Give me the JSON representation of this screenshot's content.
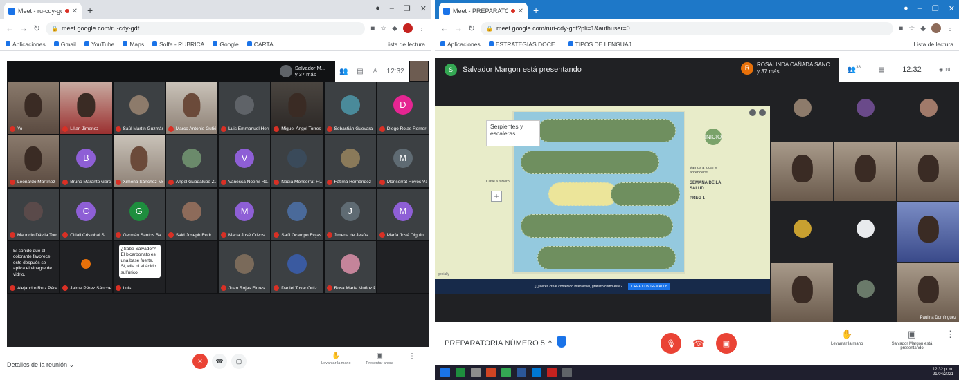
{
  "left": {
    "tab_title": "Meet - ru-cdy-gdf",
    "address": "meet.google.com/ru-cdy-gdf",
    "bookmarks": [
      "Aplicaciones",
      "Gmail",
      "YouTube",
      "Maps",
      "Solfe - RUBRICA",
      "Google",
      "CARTA ... "
    ],
    "bookmarks_right": "Lista de lectura",
    "presenter_caption": "Salvador M...\ny 37 más",
    "time": "12:32",
    "tiles": [
      {
        "type": "cam",
        "shade": "",
        "name": "Yo"
      },
      {
        "type": "cam",
        "shade": "red",
        "name": "Lilian Jimenez"
      },
      {
        "type": "avatar",
        "avatar": "",
        "color": "#8d7b6b",
        "name": "Saúl Martín Guzmán Ver..."
      },
      {
        "type": "cam",
        "shade": "light",
        "name": "Marco Antonio Gutiérrez"
      },
      {
        "type": "avatar",
        "avatar": "",
        "color": "#5f6368",
        "name": "Luis Emmanuel Herrera..."
      },
      {
        "type": "cam",
        "shade": "dark",
        "name": "Miguel Ángel Torres"
      },
      {
        "type": "avatar",
        "avatar": "",
        "color": "#4a8a9a",
        "name": "Sebastián Guevara"
      },
      {
        "type": "avatar",
        "avatar": "D",
        "color": "#e52592",
        "name": "Diego Rojas Romero"
      },
      {
        "type": "cam",
        "shade": "",
        "name": "Leonardo Martínez"
      },
      {
        "type": "avatar",
        "avatar": "B",
        "color": "#8e5fd6",
        "name": "Bruno Maranto García"
      },
      {
        "type": "cam",
        "shade": "light",
        "name": "Ximena Sánchez Mendoza"
      },
      {
        "type": "avatar",
        "avatar": "",
        "color": "#6b8a6b",
        "name": "Angel Guadalupe Zu..."
      },
      {
        "type": "avatar",
        "avatar": "V",
        "color": "#8e5fd6",
        "name": "Vanessa Noemí Ro..."
      },
      {
        "type": "avatar",
        "avatar": "",
        "color": "#3a4a5a",
        "name": "Nadia Monserrat Fl..."
      },
      {
        "type": "avatar",
        "avatar": "",
        "color": "#8a7a5a",
        "name": "Fátima Hernández"
      },
      {
        "type": "avatar",
        "avatar": "M",
        "color": "#5f6b73",
        "name": "Monserrat Reyes Vá..."
      },
      {
        "type": "avatar",
        "avatar": "",
        "color": "#5a4a4a",
        "name": "Mauricio Dávila Torres"
      },
      {
        "type": "avatar",
        "avatar": "C",
        "color": "#8e5fd6",
        "name": "Citlali Cristóbal S..."
      },
      {
        "type": "avatar",
        "avatar": "G",
        "color": "#1e8e3e",
        "name": "Germán Santos Ba..."
      },
      {
        "type": "avatar",
        "avatar": "",
        "color": "#8d6b5a",
        "name": "Said Joseph Rodr..."
      },
      {
        "type": "avatar",
        "avatar": "M",
        "color": "#8e5fd6",
        "name": "María José Olivos..."
      },
      {
        "type": "avatar",
        "avatar": "",
        "color": "#4a6a9a",
        "name": "Saúl Ocampo Rojas"
      },
      {
        "type": "avatar",
        "avatar": "J",
        "color": "#5f6b73",
        "name": "Jimena de Jesús..."
      },
      {
        "type": "avatar",
        "avatar": "M",
        "color": "#8e5fd6",
        "name": "María José Olguín..."
      },
      {
        "type": "chat",
        "name": "Alejandro Ruiz Pérez",
        "message": "El sonido que el colorante favorece este después se aplica el vinagre de vidrio."
      },
      {
        "type": "chat2",
        "name": "Jaime Pérez Sánchez"
      },
      {
        "type": "chat3",
        "name": "Luis",
        "message": "¿Sabe Salvador? El bicarbonato es una base fuerte. Sí, ella ni el ácido sulfúrico."
      },
      {
        "type": "blank",
        "name": ""
      },
      {
        "type": "avatar",
        "avatar": "",
        "color": "#7a6a5a",
        "name": "Juan Rojas Flores"
      },
      {
        "type": "avatar",
        "avatar": "",
        "color": "#3a5aa0",
        "name": "Daniel Tovar Ortiz"
      },
      {
        "type": "avatar",
        "avatar": "",
        "color": "#c4849a",
        "name": "Rosa María Muñoz Pedroza"
      },
      {
        "type": "blank",
        "name": ""
      }
    ],
    "meeting_details": "Detalles de la reunión",
    "actions": [
      "Levantar la mano",
      "Presentar ahora"
    ]
  },
  "right": {
    "tab_title": "Meet - PREPARATORIA NÚ...",
    "address": "meet.google.com/ruri-cdy-gdf?pli=1&authuser=0",
    "bookmarks": [
      "Aplicaciones",
      "ESTRATEGIAS DOCE...",
      "TIPOS DE LENGUAJ..."
    ],
    "bookmarks_right": "Lista de lectura",
    "presenting": "Salvador Margon está presentando",
    "presenter_initial": "S",
    "rose_name": "ROSALINDA CAÑADA SANC...",
    "rose_more": "y 37 más",
    "rose_initial": "R",
    "people_count": "38",
    "time": "12:32",
    "self_label": "Tú",
    "slide": {
      "title": "Serpientes y escaleras",
      "side_text": "Vamos a jugar y aprender!!!",
      "side_bold": "SEMANA DE LA SALUD",
      "side_pregunta": "PREG 1",
      "small_text": "Clave a tablero",
      "start_label": "INICIO",
      "logo": "genially"
    },
    "banner_text": "¿Quieres crear contenido interactivo, gratuito como este?",
    "banner_btn": "CREA CON GENIALLY",
    "tiles": [
      {
        "type": "avatar",
        "color": "#8d7b6b",
        "name": ""
      },
      {
        "type": "avatar",
        "color": "#6a4a8a",
        "name": ""
      },
      {
        "type": "avatar",
        "color": "#a07a6a",
        "name": ""
      },
      {
        "type": "cam",
        "shade": "",
        "name": ""
      },
      {
        "type": "cam",
        "shade": "",
        "name": ""
      },
      {
        "type": "cam",
        "shade": "",
        "name": ""
      },
      {
        "type": "avatar",
        "color": "#c8a030",
        "name": ""
      },
      {
        "type": "avatar",
        "color": "#e8eaed",
        "name": ""
      },
      {
        "type": "cam",
        "shade": "blue",
        "name": ""
      },
      {
        "type": "cam",
        "shade": "",
        "name": ""
      },
      {
        "type": "avatar",
        "color": "#6a7a6a",
        "name": ""
      },
      {
        "type": "cam",
        "shade": "",
        "name": "Paulina Domínguez"
      }
    ],
    "meeting_name": "PREPARATORIA NÚMERO 5",
    "raise_hand": "Levantar la mano",
    "presenting_now": "Salvador Margon está presentando",
    "clock_time": "12:32 p. m.",
    "clock_date": "21/04/2021"
  }
}
